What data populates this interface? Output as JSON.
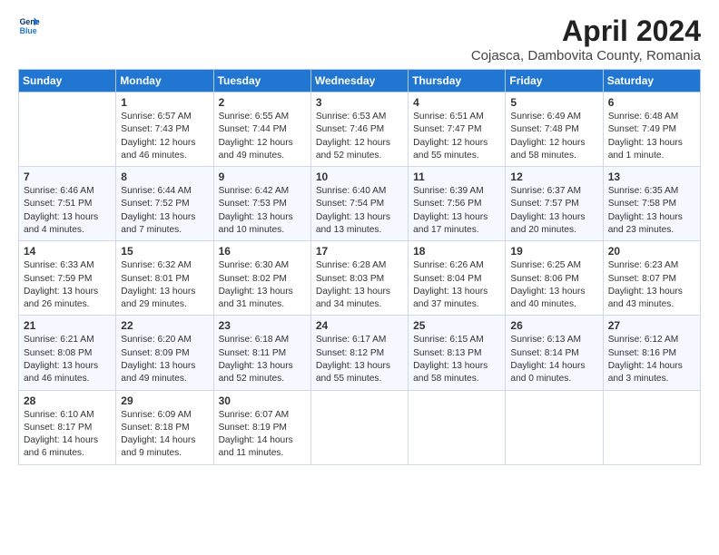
{
  "header": {
    "title": "April 2024",
    "subtitle": "Cojasca, Dambovita County, Romania",
    "logo_line1": "General",
    "logo_line2": "Blue"
  },
  "days_of_week": [
    "Sunday",
    "Monday",
    "Tuesday",
    "Wednesday",
    "Thursday",
    "Friday",
    "Saturday"
  ],
  "weeks": [
    [
      {
        "day": "",
        "content": ""
      },
      {
        "day": "1",
        "content": "Sunrise: 6:57 AM\nSunset: 7:43 PM\nDaylight: 12 hours\nand 46 minutes."
      },
      {
        "day": "2",
        "content": "Sunrise: 6:55 AM\nSunset: 7:44 PM\nDaylight: 12 hours\nand 49 minutes."
      },
      {
        "day": "3",
        "content": "Sunrise: 6:53 AM\nSunset: 7:46 PM\nDaylight: 12 hours\nand 52 minutes."
      },
      {
        "day": "4",
        "content": "Sunrise: 6:51 AM\nSunset: 7:47 PM\nDaylight: 12 hours\nand 55 minutes."
      },
      {
        "day": "5",
        "content": "Sunrise: 6:49 AM\nSunset: 7:48 PM\nDaylight: 12 hours\nand 58 minutes."
      },
      {
        "day": "6",
        "content": "Sunrise: 6:48 AM\nSunset: 7:49 PM\nDaylight: 13 hours\nand 1 minute."
      }
    ],
    [
      {
        "day": "7",
        "content": "Sunrise: 6:46 AM\nSunset: 7:51 PM\nDaylight: 13 hours\nand 4 minutes."
      },
      {
        "day": "8",
        "content": "Sunrise: 6:44 AM\nSunset: 7:52 PM\nDaylight: 13 hours\nand 7 minutes."
      },
      {
        "day": "9",
        "content": "Sunrise: 6:42 AM\nSunset: 7:53 PM\nDaylight: 13 hours\nand 10 minutes."
      },
      {
        "day": "10",
        "content": "Sunrise: 6:40 AM\nSunset: 7:54 PM\nDaylight: 13 hours\nand 13 minutes."
      },
      {
        "day": "11",
        "content": "Sunrise: 6:39 AM\nSunset: 7:56 PM\nDaylight: 13 hours\nand 17 minutes."
      },
      {
        "day": "12",
        "content": "Sunrise: 6:37 AM\nSunset: 7:57 PM\nDaylight: 13 hours\nand 20 minutes."
      },
      {
        "day": "13",
        "content": "Sunrise: 6:35 AM\nSunset: 7:58 PM\nDaylight: 13 hours\nand 23 minutes."
      }
    ],
    [
      {
        "day": "14",
        "content": "Sunrise: 6:33 AM\nSunset: 7:59 PM\nDaylight: 13 hours\nand 26 minutes."
      },
      {
        "day": "15",
        "content": "Sunrise: 6:32 AM\nSunset: 8:01 PM\nDaylight: 13 hours\nand 29 minutes."
      },
      {
        "day": "16",
        "content": "Sunrise: 6:30 AM\nSunset: 8:02 PM\nDaylight: 13 hours\nand 31 minutes."
      },
      {
        "day": "17",
        "content": "Sunrise: 6:28 AM\nSunset: 8:03 PM\nDaylight: 13 hours\nand 34 minutes."
      },
      {
        "day": "18",
        "content": "Sunrise: 6:26 AM\nSunset: 8:04 PM\nDaylight: 13 hours\nand 37 minutes."
      },
      {
        "day": "19",
        "content": "Sunrise: 6:25 AM\nSunset: 8:06 PM\nDaylight: 13 hours\nand 40 minutes."
      },
      {
        "day": "20",
        "content": "Sunrise: 6:23 AM\nSunset: 8:07 PM\nDaylight: 13 hours\nand 43 minutes."
      }
    ],
    [
      {
        "day": "21",
        "content": "Sunrise: 6:21 AM\nSunset: 8:08 PM\nDaylight: 13 hours\nand 46 minutes."
      },
      {
        "day": "22",
        "content": "Sunrise: 6:20 AM\nSunset: 8:09 PM\nDaylight: 13 hours\nand 49 minutes."
      },
      {
        "day": "23",
        "content": "Sunrise: 6:18 AM\nSunset: 8:11 PM\nDaylight: 13 hours\nand 52 minutes."
      },
      {
        "day": "24",
        "content": "Sunrise: 6:17 AM\nSunset: 8:12 PM\nDaylight: 13 hours\nand 55 minutes."
      },
      {
        "day": "25",
        "content": "Sunrise: 6:15 AM\nSunset: 8:13 PM\nDaylight: 13 hours\nand 58 minutes."
      },
      {
        "day": "26",
        "content": "Sunrise: 6:13 AM\nSunset: 8:14 PM\nDaylight: 14 hours\nand 0 minutes."
      },
      {
        "day": "27",
        "content": "Sunrise: 6:12 AM\nSunset: 8:16 PM\nDaylight: 14 hours\nand 3 minutes."
      }
    ],
    [
      {
        "day": "28",
        "content": "Sunrise: 6:10 AM\nSunset: 8:17 PM\nDaylight: 14 hours\nand 6 minutes."
      },
      {
        "day": "29",
        "content": "Sunrise: 6:09 AM\nSunset: 8:18 PM\nDaylight: 14 hours\nand 9 minutes."
      },
      {
        "day": "30",
        "content": "Sunrise: 6:07 AM\nSunset: 8:19 PM\nDaylight: 14 hours\nand 11 minutes."
      },
      {
        "day": "",
        "content": ""
      },
      {
        "day": "",
        "content": ""
      },
      {
        "day": "",
        "content": ""
      },
      {
        "day": "",
        "content": ""
      }
    ]
  ]
}
